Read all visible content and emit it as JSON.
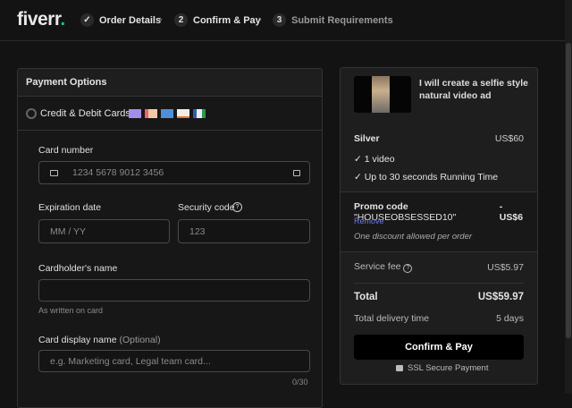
{
  "header": {
    "logo": "fiverr",
    "logo_dot": ".",
    "steps": [
      {
        "marker": "✓",
        "label": "Order Details"
      },
      {
        "marker": "2",
        "label": "Confirm & Pay"
      },
      {
        "marker": "3",
        "label": "Submit Requirements"
      }
    ]
  },
  "payment": {
    "title": "Payment Options",
    "method": "Credit & Debit Cards",
    "card_number": {
      "label": "Card number",
      "placeholder": "1234 5678 9012 3456"
    },
    "expiration": {
      "label": "Expiration date",
      "placeholder": "MM / YY"
    },
    "security": {
      "label": "Security code",
      "placeholder": "123"
    },
    "holder": {
      "label": "Cardholder's name",
      "value": "",
      "hint": "As written on card"
    },
    "display": {
      "label": "Card display name",
      "optional": "(Optional)",
      "placeholder": "e.g. Marketing card, Legal team card...",
      "counter": "0/30"
    }
  },
  "summary": {
    "gig_title": "I will create a selfie style natural video ad",
    "package": "Silver",
    "package_price": "US$60",
    "features": [
      "1 video",
      "Up to 30 seconds Running Time"
    ],
    "promo_label": "Promo code",
    "promo_code": "\"HOUSEOBSESSED10\"",
    "promo_discount": "-US$6",
    "remove": "Remove",
    "promo_note": "One discount allowed per order",
    "service_fee_label": "Service fee",
    "service_fee": "US$5.97",
    "total_label": "Total",
    "total": "US$59.97",
    "delivery_label": "Total delivery time",
    "delivery": "5 days",
    "confirm": "Confirm & Pay",
    "ssl": "SSL Secure Payment"
  },
  "colors": {
    "accent": "#1dbf73",
    "link": "#6f7cf0"
  }
}
